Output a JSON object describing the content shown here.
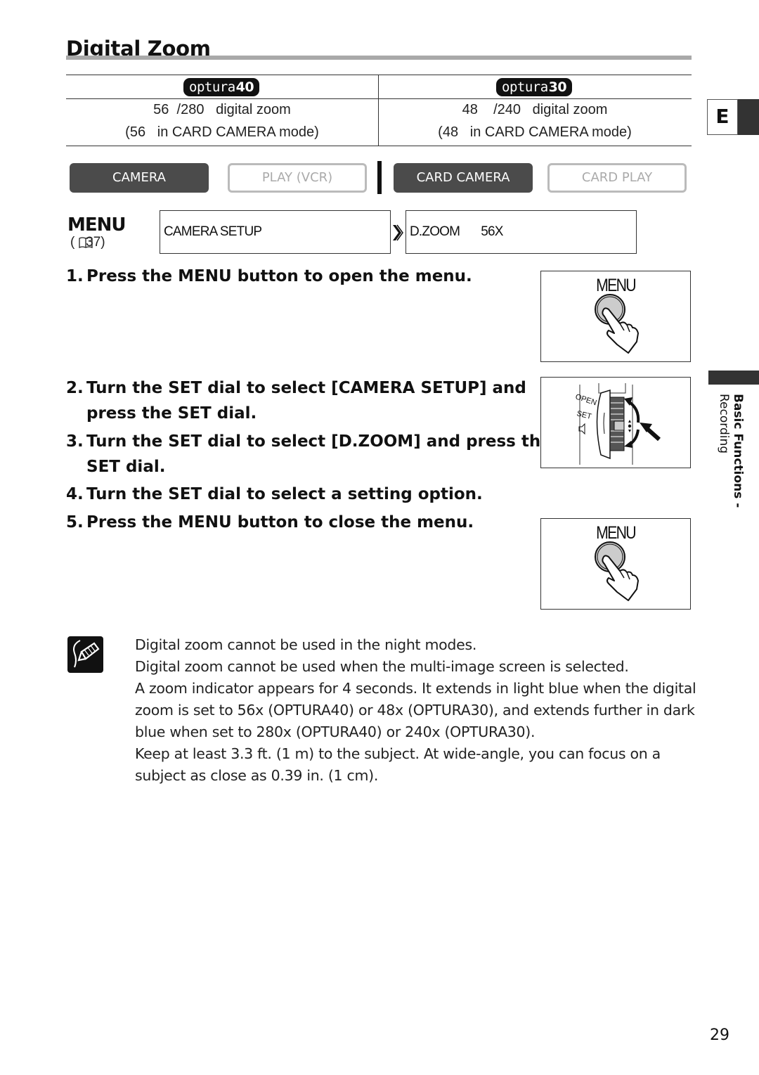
{
  "page": {
    "title": "Digital Zoom",
    "page_number": "29",
    "language_tab": "E",
    "section_tab": {
      "line1": "Basic Functions -",
      "line2": "Recording"
    }
  },
  "models": [
    {
      "badge_prefix": "optura",
      "badge_number": "40",
      "zoom_line": "56  /280   digital zoom",
      "card_line": "(56   in CARD CAMERA mode)"
    },
    {
      "badge_prefix": "optura",
      "badge_number": "30",
      "zoom_line": "48    /240   digital zoom",
      "card_line": "(48   in CARD CAMERA mode)"
    }
  ],
  "modes": [
    {
      "label": "CAMERA",
      "active": true
    },
    {
      "label": "PLAY (VCR)",
      "active": false
    },
    {
      "label": "CARD CAMERA",
      "active": true
    },
    {
      "label": "CARD PLAY",
      "active": false
    }
  ],
  "menu_path": {
    "menu_label": "MENU",
    "page_ref": "(   37)",
    "book_icon": "book-icon",
    "submenu": "CAMERA SETUP",
    "item": "D.ZOOM",
    "value": "56X"
  },
  "steps": [
    {
      "num": "1.",
      "text": "Press the MENU button to open the menu.",
      "cont": ""
    },
    {
      "num": "2.",
      "text": "Turn the SET dial to select [CAMERA SETUP] and",
      "cont": "press the SET dial."
    },
    {
      "num": "3.",
      "text": "Turn the SET dial to select [D.ZOOM] and press the",
      "cont": "SET dial."
    },
    {
      "num": "4.",
      "text": "Turn the SET dial to select a setting option.",
      "cont": ""
    },
    {
      "num": "5.",
      "text": "Press the MENU button to close the menu.",
      "cont": ""
    }
  ],
  "illustrations": {
    "menu_button_label": "MENU",
    "dial_labels": [
      "OPEN",
      "SET"
    ]
  },
  "notes": [
    "Digital zoom cannot be used in the night modes.",
    "Digital zoom cannot be used when the multi-image screen is selected.",
    "A zoom indicator appears for 4 seconds. It extends in light blue when the digital zoom is set to 56x (OPTURA40) or 48x (OPTURA30), and extends further in dark blue when set to 280x (OPTURA40) or 240x (OPTURA30).",
    "Keep at least 3.3 ft. (1 m) to the subject. At wide-angle, you can focus on a subject as close as 0.39 in. (1 cm)."
  ]
}
